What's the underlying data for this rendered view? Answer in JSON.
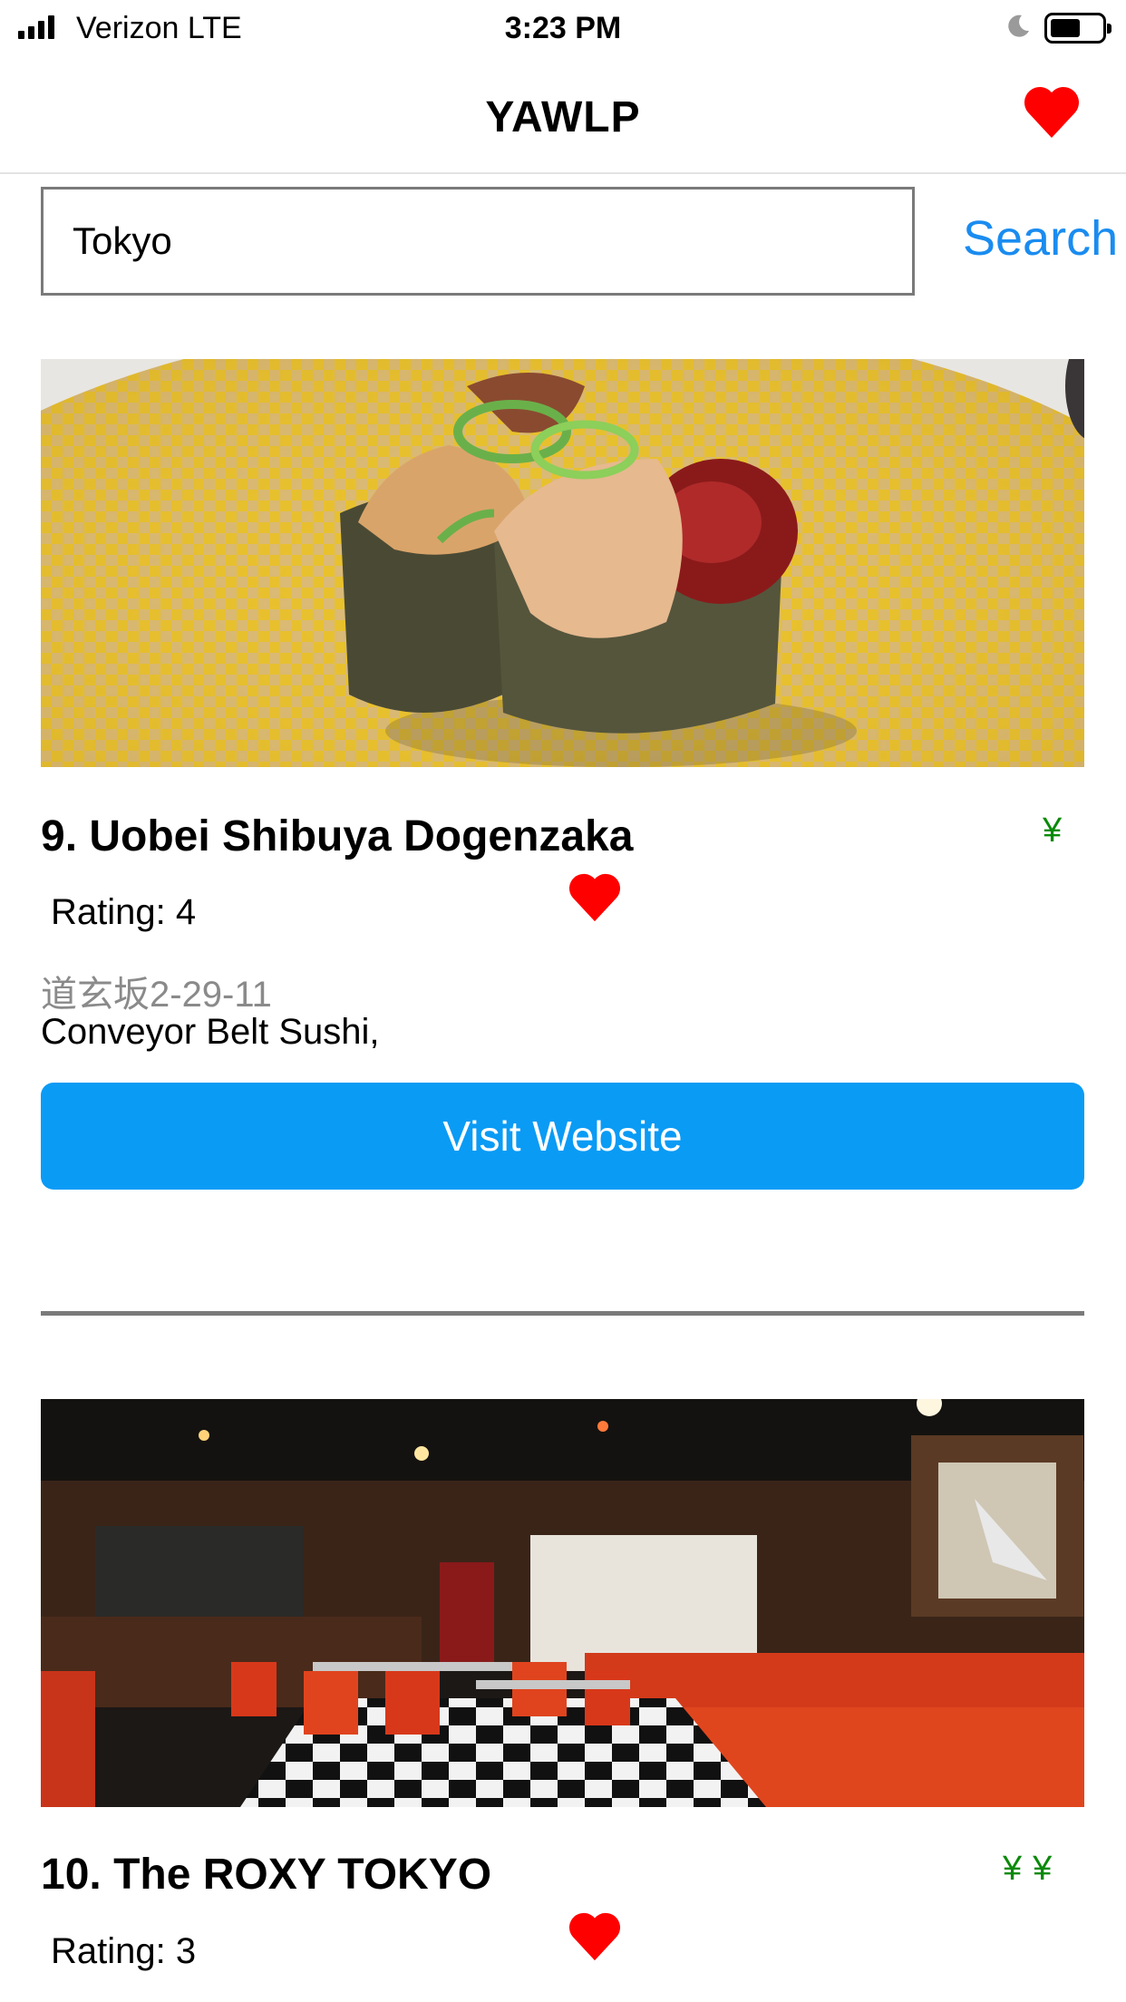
{
  "status_bar": {
    "carrier": "Verizon  LTE",
    "time": "3:23 PM"
  },
  "nav": {
    "title": "YAWLP",
    "favorites_icon": "heart-icon"
  },
  "search": {
    "value": "Tokyo",
    "button_label": "Search"
  },
  "results": [
    {
      "title": "9. Uobei Shibuya Dogenzaka",
      "price": "¥",
      "rating": "Rating: 4",
      "address": "道玄坂2-29-11",
      "categories": "Conveyor Belt Sushi,",
      "button_label": "Visit Website",
      "image": "sushi-photo"
    },
    {
      "title": "10. The ROXY TOKYO",
      "price": "¥¥",
      "rating": "Rating: 3",
      "image": "diner-interior-photo"
    }
  ],
  "colors": {
    "accent": "#1a8cf0",
    "button": "#0a9bf5",
    "heart": "#ff0000",
    "price": "#0a8a0a"
  }
}
